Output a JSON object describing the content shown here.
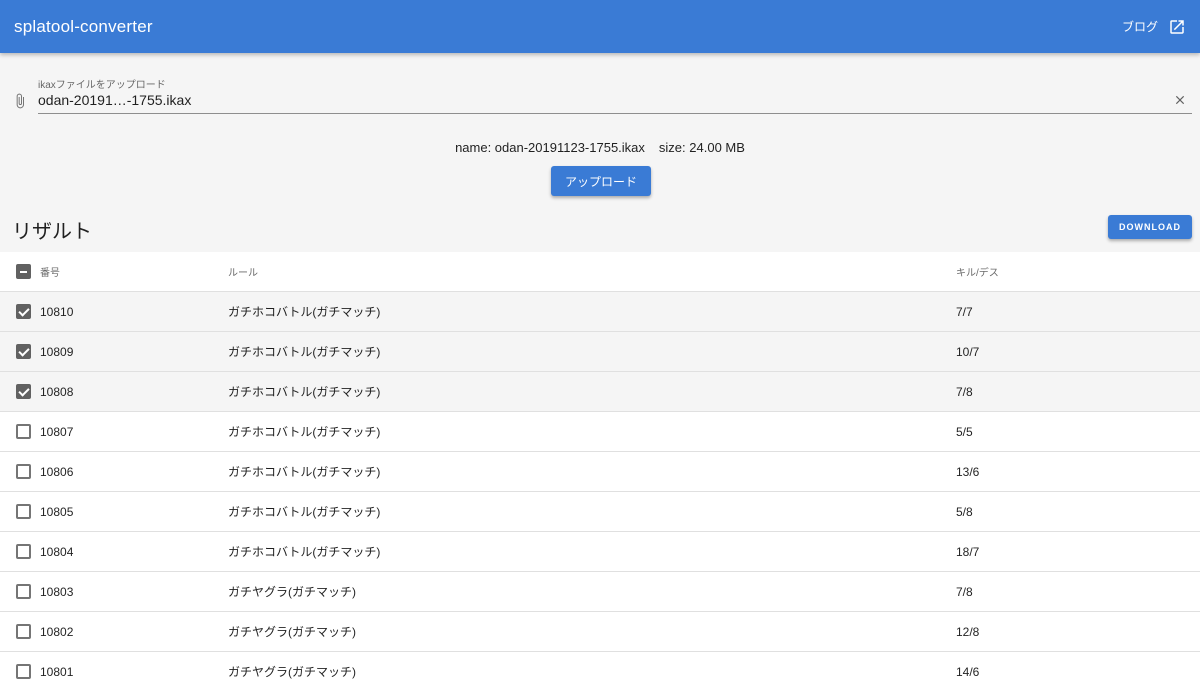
{
  "app": {
    "title": "splatool-converter",
    "blog_label": "ブログ"
  },
  "file_input": {
    "label": "ikaxファイルをアップロード",
    "value": "odan-20191…-1755.ikax",
    "icon": "paperclip-icon",
    "clear_icon": "close-icon"
  },
  "file_info": {
    "name": "name: odan-20191123-1755.ikax",
    "size": "size: 24.00 MB"
  },
  "upload_button": "アップロード",
  "results": {
    "title": "リザルト",
    "download_button": "DOWNLOAD"
  },
  "table": {
    "select_all_state": "indeterminate",
    "headers": {
      "number": "番号",
      "rule": "ルール",
      "kill_death": "キル/デス"
    },
    "rows": [
      {
        "number": "10810",
        "rule": "ガチホコバトル(ガチマッチ)",
        "kd": "7/7",
        "checked": true
      },
      {
        "number": "10809",
        "rule": "ガチホコバトル(ガチマッチ)",
        "kd": "10/7",
        "checked": true
      },
      {
        "number": "10808",
        "rule": "ガチホコバトル(ガチマッチ)",
        "kd": "7/8",
        "checked": true
      },
      {
        "number": "10807",
        "rule": "ガチホコバトル(ガチマッチ)",
        "kd": "5/5",
        "checked": false
      },
      {
        "number": "10806",
        "rule": "ガチホコバトル(ガチマッチ)",
        "kd": "13/6",
        "checked": false
      },
      {
        "number": "10805",
        "rule": "ガチホコバトル(ガチマッチ)",
        "kd": "5/8",
        "checked": false
      },
      {
        "number": "10804",
        "rule": "ガチホコバトル(ガチマッチ)",
        "kd": "18/7",
        "checked": false
      },
      {
        "number": "10803",
        "rule": "ガチヤグラ(ガチマッチ)",
        "kd": "7/8",
        "checked": false
      },
      {
        "number": "10802",
        "rule": "ガチヤグラ(ガチマッチ)",
        "kd": "12/8",
        "checked": false
      },
      {
        "number": "10801",
        "rule": "ガチヤグラ(ガチマッチ)",
        "kd": "14/6",
        "checked": false
      }
    ]
  },
  "colors": {
    "primary": "#3a7bd5",
    "checkbox": "#616161",
    "selected_row": "#f5f5f5"
  }
}
